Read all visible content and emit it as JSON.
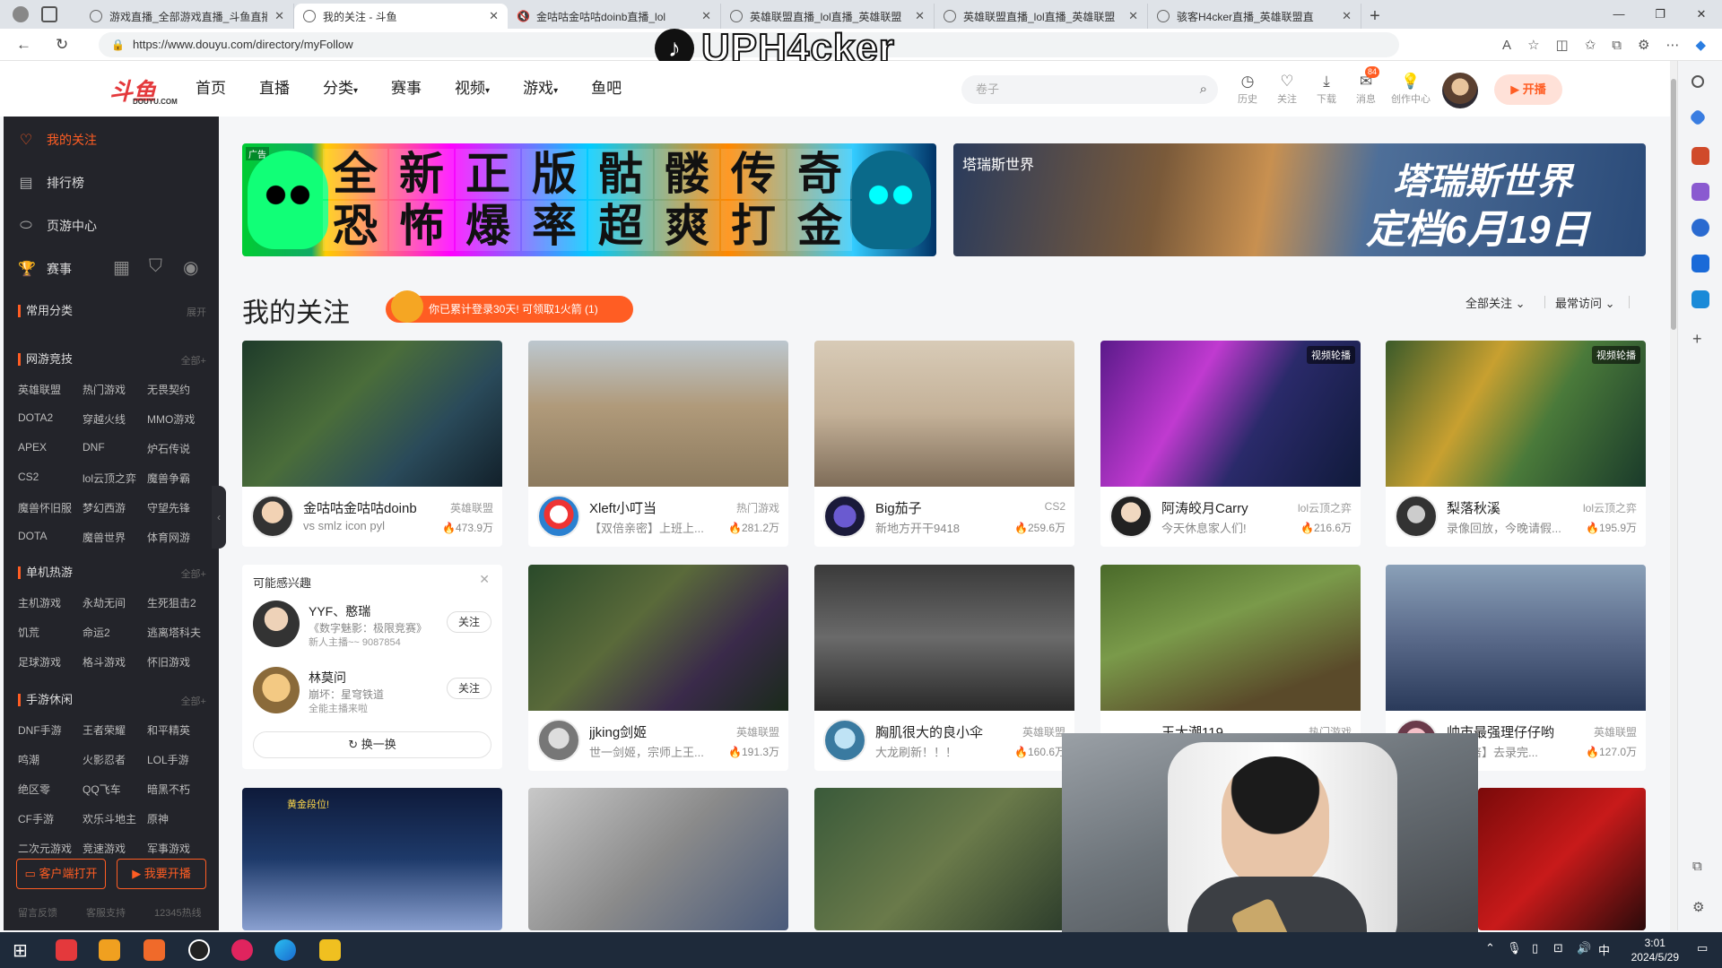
{
  "browser": {
    "tabs": [
      {
        "title": "游戏直播_全部游戏直播_斗鱼直播"
      },
      {
        "title": "我的关注 - 斗鱼"
      },
      {
        "title": "金咕咕金咕咕doinb直播_lol"
      },
      {
        "title": "英雄联盟直播_lol直播_英雄联盟"
      },
      {
        "title": "英雄联盟直播_lol直播_英雄联盟"
      },
      {
        "title": "骇客H4cker直播_英雄联盟直"
      }
    ],
    "url": "https://www.douyu.com/directory/myFollow"
  },
  "watermark": {
    "text": "UPH4cker"
  },
  "header": {
    "logo_text": "斗鱼",
    "logo_sub": "DOUYU.COM",
    "nav": [
      "首页",
      "直播",
      "分类",
      "赛事",
      "视频",
      "游戏",
      "鱼吧"
    ],
    "search_placeholder": "卷子",
    "icons": [
      {
        "label": "历史",
        "icon": "history-icon"
      },
      {
        "label": "关注",
        "icon": "heart-icon"
      },
      {
        "label": "下载",
        "icon": "download-icon"
      },
      {
        "label": "消息",
        "icon": "message-icon",
        "badge": "84"
      },
      {
        "label": "创作中心",
        "icon": "bulb-icon"
      }
    ],
    "live_button": "开播"
  },
  "sidebar": {
    "items": [
      {
        "label": "我的关注",
        "icon": "heart-icon"
      },
      {
        "label": "排行榜",
        "icon": "rank-icon"
      },
      {
        "label": "页游中心",
        "icon": "game-center-icon"
      },
      {
        "label": "赛事",
        "icon": "trophy-icon"
      }
    ],
    "common": {
      "title": "常用分类",
      "more": "展开"
    },
    "sections": [
      {
        "title": "网游竞技",
        "more": "全部+",
        "items": [
          "英雄联盟",
          "热门游戏",
          "无畏契约",
          "DOTA2",
          "穿越火线",
          "MMO游戏",
          "APEX",
          "DNF",
          "炉石传说",
          "CS2",
          "lol云顶之弈",
          "魔兽争霸",
          "魔兽怀旧服",
          "梦幻西游",
          "守望先锋",
          "DOTA",
          "魔兽世界",
          "体育网游"
        ]
      },
      {
        "title": "单机热游",
        "more": "全部+",
        "items": [
          "主机游戏",
          "永劫无间",
          "生死狙击2",
          "饥荒",
          "命运2",
          "逃离塔科夫",
          "足球游戏",
          "格斗游戏",
          "怀旧游戏"
        ]
      },
      {
        "title": "手游休闲",
        "more": "全部+",
        "items": [
          "DNF手游",
          "王者荣耀",
          "和平精英",
          "鸣潮",
          "火影忍者",
          "LOL手游",
          "绝区零",
          "QQ飞车",
          "暗黑不朽",
          "CF手游",
          "欢乐斗地主",
          "原神",
          "二次元游戏",
          "竞速游戏",
          "军事游戏"
        ]
      }
    ],
    "btn_client": "客户端打开",
    "btn_live": "我要开播",
    "footer": [
      "留言反馈",
      "客服支持",
      "12345热线"
    ]
  },
  "banners": {
    "ad_label": "广告",
    "banner1_chars": [
      "全",
      "新",
      "正",
      "版",
      "骷",
      "髅",
      "传",
      "奇",
      "恐",
      "怖",
      "爆",
      "率",
      "超",
      "爽",
      "打",
      "金"
    ],
    "banner2_logo": "塔瑞斯世界",
    "banner2_title": "塔瑞斯世界",
    "banner2_sub": "定档6月19日"
  },
  "main": {
    "title": "我的关注",
    "promo": "你已累计登录30天! 可领取1火箭 (1)",
    "sort_all": "全部关注",
    "sort_recent": "最常访问",
    "cards": [
      {
        "name": "金咕咕金咕咕doinb",
        "cat": "英雄联盟",
        "desc": "vs smlz icon pyl",
        "heat": "473.9万",
        "tag": ""
      },
      {
        "name": "Xleft小叮当",
        "cat": "热门游戏",
        "desc": "【双倍亲密】上班上...",
        "heat": "281.2万",
        "tag": ""
      },
      {
        "name": "Big茄子",
        "cat": "CS2",
        "desc": "新地方开干9418",
        "heat": "259.6万",
        "tag": ""
      },
      {
        "name": "阿涛皎月Carry",
        "cat": "lol云顶之弈",
        "desc": "今天休息家人们!",
        "heat": "216.6万",
        "tag": "视频轮播"
      },
      {
        "name": "梨落秋溪",
        "cat": "lol云顶之弈",
        "desc": "录像回放，今晚请假...",
        "heat": "195.9万",
        "tag": "视频轮播"
      },
      {
        "name": "jjking剑姬",
        "cat": "英雄联盟",
        "desc": "世一剑姬，宗师上王...",
        "heat": "191.3万",
        "tag": ""
      },
      {
        "name": "胸肌很大的良小伞",
        "cat": "英雄联盟",
        "desc": "大龙刷新！！！",
        "heat": "160.6万",
        "tag": ""
      },
      {
        "name": "王大潮119",
        "cat": "热门游戏",
        "desc": "",
        "heat": "",
        "tag": ""
      },
      {
        "name": "帅市最强理仔仔哟",
        "cat": "英雄联盟",
        "desc": "【双倍】去录完...",
        "heat": "127.0万",
        "tag": ""
      }
    ],
    "bottom_card_text": "黄金段位!"
  },
  "recommend": {
    "title": "可能感兴趣",
    "items": [
      {
        "name": "YYF、憨瑞",
        "desc1": "《数字魅影：极限竞赛》",
        "desc2": "新人主播~~ 9087854",
        "follow": "关注"
      },
      {
        "name": "林莫问",
        "desc1": "崩坏：星穹铁道",
        "desc2": "全能主播来啦",
        "follow": "关注"
      }
    ],
    "refresh": "换一换"
  },
  "taskbar": {
    "time": "3:01",
    "date": "2024/5/29",
    "ime": "中"
  }
}
